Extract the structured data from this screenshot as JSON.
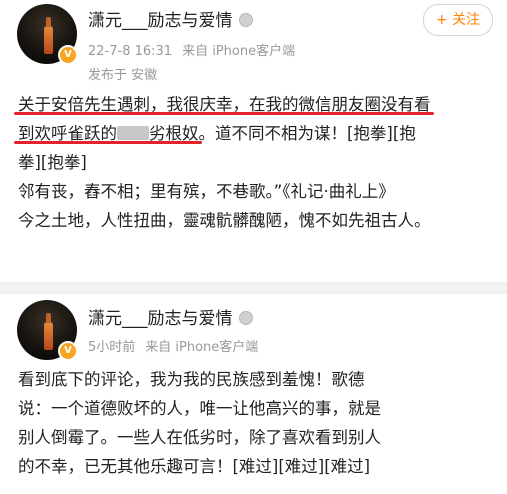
{
  "post1": {
    "username": "潇元___励志与爱情",
    "time": "22-7-8 16:31",
    "source": "来自 iPhone客户端",
    "location": "发布于 安徽",
    "follow_label": "+ 关注",
    "line1": "关于安倍先生遇刺，我很庆幸，在我的微信朋友圈没有看",
    "line2_a": "到欢呼雀跃的",
    "line2_b": "劣根奴",
    "line2_c": "。道不同不相为谋！[抱拳][抱",
    "line3": "拳][抱拳]",
    "line4": "邻有丧，舂不相；里有殡，不巷歌。”《礼记·曲礼上》",
    "line5": "今之土地，人性扭曲，靈魂骯髒醜陋，愧不如先祖古人。"
  },
  "post2": {
    "username": "潇元___励志与爱情",
    "time": "5小时前",
    "source": "来自 iPhone客户端",
    "line1": "看到底下的评论，我为我的民族感到羞愧！歌德",
    "line2": "说：一个道德败坏的人，唯一让他高兴的事，就是",
    "line3": "别人倒霉了。一些人在低劣时，除了喜欢看到别人",
    "line4": "的不幸，已无其他乐趣可言！[难过][难过][难过]"
  },
  "colors": {
    "accent_orange": "#ff8200",
    "highlight_red": "#e0242b",
    "meta_gray": "#999999",
    "verified_badge": "#f5a623"
  }
}
